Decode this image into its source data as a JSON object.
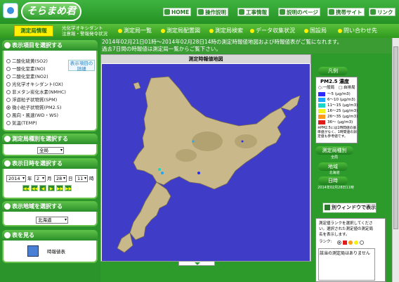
{
  "header": {
    "logo_text": "そらまめ君",
    "buttons": [
      {
        "label": "HOME"
      },
      {
        "label": "操作説明"
      },
      {
        "label": "工事情報"
      },
      {
        "label": "説明のページ"
      },
      {
        "label": "携帯サイト"
      },
      {
        "label": "リンク"
      }
    ]
  },
  "nav": {
    "active": "測定局情報",
    "sub_line1": "光化学オキシダント",
    "sub_line2": "注意報・警報発令状況",
    "items": [
      {
        "label": "測定局一覧"
      },
      {
        "label": "測定局配置図"
      },
      {
        "label": "測定局検索"
      },
      {
        "label": "データ収集状況"
      },
      {
        "label": "国設局"
      },
      {
        "label": "問い合わせ先"
      }
    ]
  },
  "info": {
    "line1": "2014年02月21日01時～2014年02月28日14時の測定時報値地図および時報値表がご覧になれます。",
    "line2": "過去7日間の時報値は測定局一覧からご覧下さい。"
  },
  "sidebar": {
    "items_panel": {
      "title": "表示項目を選択する",
      "detail_label": "表示項目の詳細",
      "items": [
        {
          "label": "二酸化硫黄(SO2)",
          "selected": false
        },
        {
          "label": "一酸化窒素(NO)",
          "selected": false
        },
        {
          "label": "二酸化窒素(NO2)",
          "selected": false
        },
        {
          "label": "光化学オキシダント(OX)",
          "selected": false
        },
        {
          "label": "非メタン炭化水素(NMHC)",
          "selected": false
        },
        {
          "label": "浮遊粒子状物質(SPM)",
          "selected": false
        },
        {
          "label": "微小粒子状物質(PM2.5)",
          "selected": true
        },
        {
          "label": "風向・風速(WD・WS)",
          "selected": false
        },
        {
          "label": "気温(TEMP)",
          "selected": false
        }
      ]
    },
    "type_panel": {
      "title": "測定局種別を選択する",
      "value": "全局"
    },
    "date_panel": {
      "title": "表示日時を選択する",
      "year": "2014",
      "year_unit": "年",
      "month": "2",
      "month_unit": "月",
      "day": "28",
      "day_unit": "日",
      "hour": "11",
      "hour_unit": "時",
      "nav_buttons": [
        "◀◀",
        "◀◀",
        "◀",
        "▶",
        "▶▶",
        "▶▶"
      ]
    },
    "area_panel": {
      "title": "表示地域を選択する",
      "value": "北海道"
    },
    "table_panel": {
      "title": "表を見る",
      "item_label": "時報値表"
    }
  },
  "map": {
    "title": "測定時報値地図"
  },
  "legend": {
    "title": "凡例",
    "box_title": "PM2.5 濃度",
    "marker_general": "一般局",
    "marker_auto": "自排局",
    "ranges": [
      {
        "range": "～5",
        "unit": "(μg/m3)",
        "color": "#2b2bff"
      },
      {
        "range": "6～10",
        "unit": "(μg/m3)",
        "color": "#1fa6ff"
      },
      {
        "range": "11～15",
        "unit": "(μg/m3)",
        "color": "#19d6c9"
      },
      {
        "range": "16～25",
        "unit": "(μg/m3)",
        "color": "#f2f21a"
      },
      {
        "range": "26～35",
        "unit": "(μg/m3)",
        "color": "#ff9a1a"
      },
      {
        "range": "36～",
        "unit": "(μg/m3)",
        "color": "#e01b1b"
      }
    ],
    "note_lines": [
      "※PM2.5には1時間値の基",
      "準値がなく、1時間値の測",
      "定値も参考値です。"
    ],
    "station_type_label": "測定局種別",
    "station_type_value": "全局",
    "area_label": "地域",
    "area_value": "北海道",
    "datetime_label": "日時",
    "datetime_value": "2014年02月28日11時",
    "window_button": "別ウィンドウで表示"
  },
  "rank": {
    "desc_line1": "測定値ランクを選択してくださ",
    "desc_line2": "い。選択された測定値の測定局",
    "desc_line3": "名を表示します。",
    "rank_label": "ランク:",
    "rank_colors": [
      "#e01b1b",
      "#ff9a1a",
      "#f2f21a",
      "#ffffff"
    ],
    "list_text": "該当の測定局はありません"
  }
}
